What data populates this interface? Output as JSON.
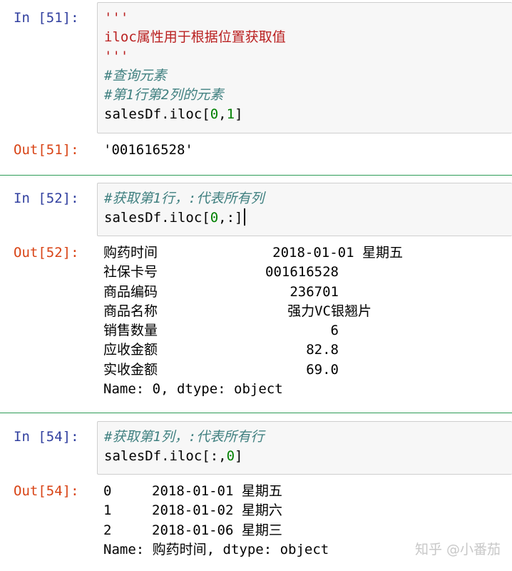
{
  "cells": [
    {
      "in_prompt": "In [51]:",
      "code": {
        "docstring_open": "'''",
        "docstring_text": "iloc属性用于根据位置获取值",
        "docstring_close": "'''",
        "comment1": "#查询元素",
        "comment2": "#第1行第2列的元素",
        "code_prefix": "salesDf.iloc[",
        "arg1": "0",
        "comma": ",",
        "arg2": "1",
        "code_suffix": "]"
      },
      "out_prompt": "Out[51]:",
      "output": "'001616528'"
    },
    {
      "in_prompt": "In [52]:",
      "code": {
        "comment1": "#获取第1行，:代表所有列",
        "code_prefix": "salesDf.iloc[",
        "arg1": "0",
        "code_suffix": ",:]"
      },
      "out_prompt": "Out[52]:",
      "output_rows": [
        {
          "label": "购药时间",
          "value": "2018-01-01 星期五"
        },
        {
          "label": "社保卡号",
          "value": "001616528"
        },
        {
          "label": "商品编码",
          "value": "236701"
        },
        {
          "label": "商品名称",
          "value": "强力VC银翘片"
        },
        {
          "label": "销售数量",
          "value": "6"
        },
        {
          "label": "应收金额",
          "value": "82.8"
        },
        {
          "label": "实收金额",
          "value": "69.0"
        }
      ],
      "output_footer": "Name: 0, dtype: object"
    },
    {
      "in_prompt": "In [54]:",
      "code": {
        "comment1": "#获取第1列，:代表所有行",
        "code_prefix": "salesDf.iloc[:,",
        "arg1": "0",
        "code_suffix": "]"
      },
      "out_prompt": "Out[54]:",
      "output_rows": [
        {
          "index": "0",
          "value": "2018-01-01 星期五"
        },
        {
          "index": "1",
          "value": "2018-01-02 星期六"
        },
        {
          "index": "2",
          "value": "2018-01-06 星期三"
        }
      ],
      "output_footer": "Name: 购药时间, dtype: object"
    }
  ],
  "watermark": "知乎 @小番茄"
}
